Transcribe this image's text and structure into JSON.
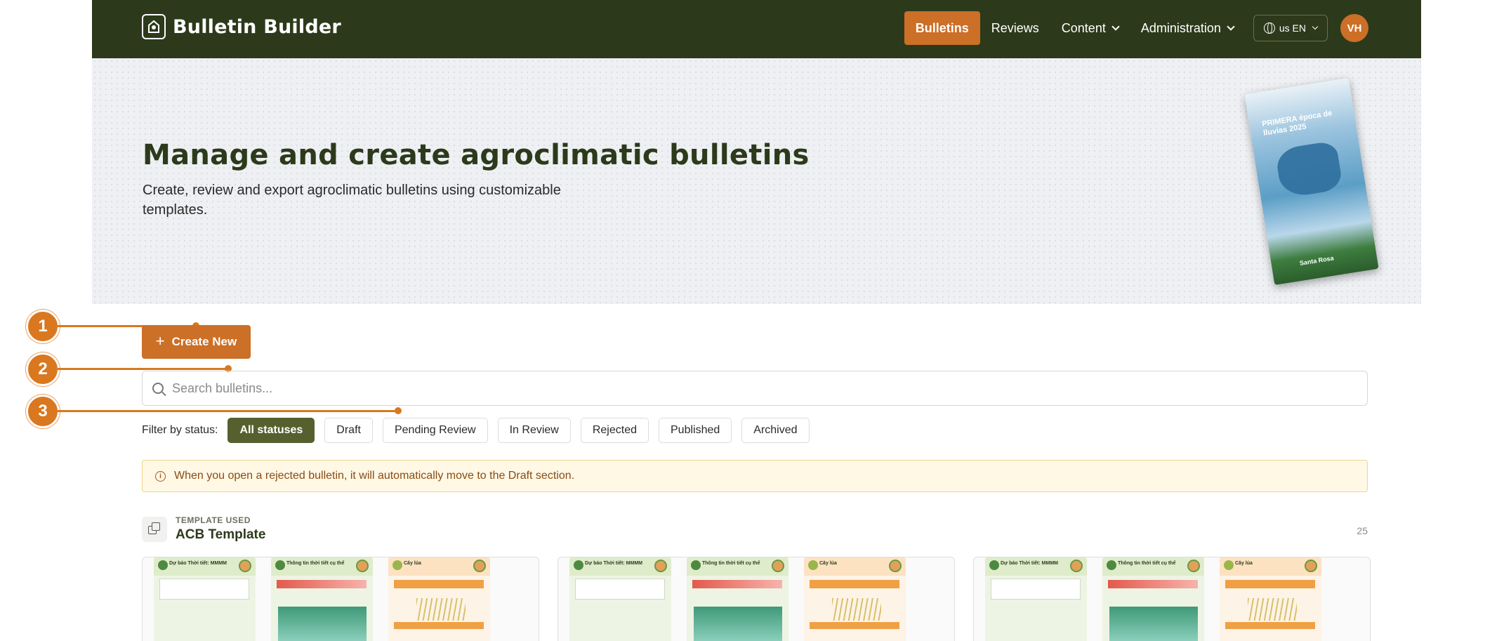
{
  "nav": {
    "brand": "Bulletin Builder",
    "links": [
      {
        "label": "Bulletins",
        "active": true
      },
      {
        "label": "Reviews",
        "active": false
      },
      {
        "label": "Content",
        "active": false
      },
      {
        "label": "Administration",
        "active": false
      }
    ],
    "language": "us EN",
    "avatar_initials": "VH",
    "colors": {
      "bar": "#2c3a1b",
      "accent": "#cc6f27"
    }
  },
  "hero": {
    "title": "Manage and create agroclimatic bulletins",
    "subtitle": "Create, review and export agroclimatic bulletins using customizable templates.",
    "poster": {
      "title": "PRIMERA época de lluvias 2025",
      "footer": "Santa Rosa"
    }
  },
  "annotations": {
    "m1": "1",
    "m2": "2",
    "m3": "3"
  },
  "actions": {
    "create_label": "Create New",
    "plus_icon": "+"
  },
  "search": {
    "placeholder": "Search bulletins..."
  },
  "filters": {
    "label": "Filter by status:",
    "options": [
      "All statuses",
      "Draft",
      "Pending Review",
      "In Review",
      "Rejected",
      "Published",
      "Archived"
    ],
    "selected": "All statuses"
  },
  "notice": {
    "text": "When you open a rejected bulletin, it will automatically move to the Draft section."
  },
  "template_group": {
    "kicker": "TEMPLATE USED",
    "name": "ACB Template",
    "count": "25",
    "cards": [
      {
        "pages": [
          "Dự báo Thời tiết: MMMM",
          "Thông tin thời tiết cụ thể",
          "Cây lúa"
        ]
      },
      {
        "pages": [
          "Dự báo Thời tiết: MMMM",
          "Thông tin thời tiết cụ thể",
          "Cây lúa"
        ]
      },
      {
        "pages": [
          "Dự báo Thời tiết: MMMM",
          "Thông tin thời tiết cụ thể",
          "Cây lúa"
        ]
      }
    ]
  }
}
